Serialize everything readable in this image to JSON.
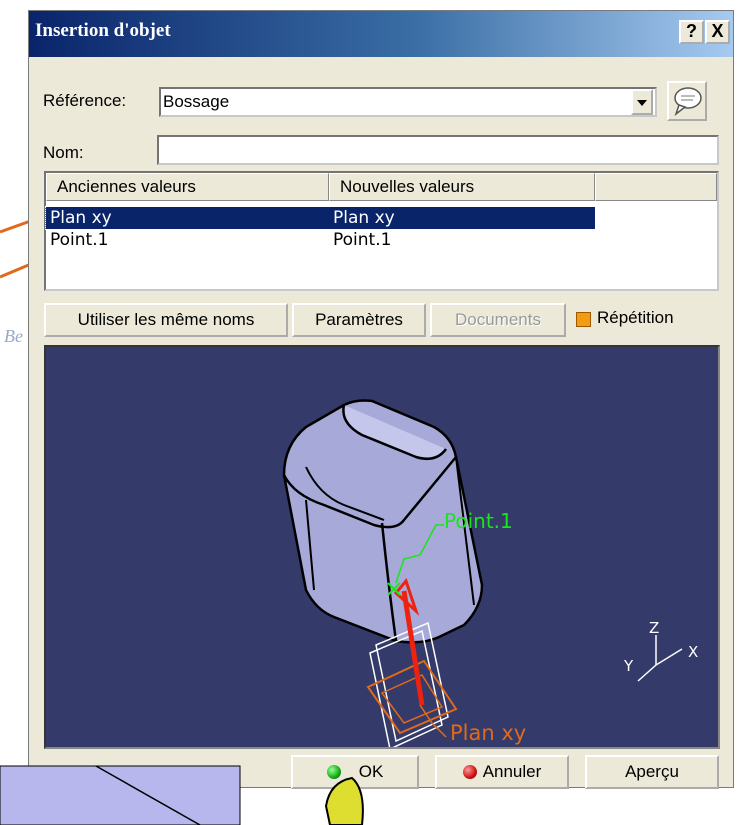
{
  "dialog": {
    "title": "Insertion d'objet",
    "help_button": "?",
    "close_button": "X",
    "reference_label": "Référence:",
    "reference_value": "Bossage",
    "name_label": "Nom:",
    "name_value": "",
    "columns": [
      "Anciennes valeurs",
      "Nouvelles valeurs"
    ],
    "rows": [
      {
        "old": "Plan xy",
        "new": "Plan xy",
        "selected": true
      },
      {
        "old": "Point.1",
        "new": "Point.1",
        "selected": false
      }
    ],
    "buttons": {
      "same_names": "Utiliser les même noms",
      "parameters": "Paramètres",
      "documents": "Documents",
      "repetition": "Répétition"
    },
    "viewer": {
      "point_label": "Point.1",
      "plane_label": "Plan xy",
      "axis_x": "X",
      "axis_y": "Y",
      "axis_z": "Z"
    },
    "footer": {
      "ok": "OK",
      "cancel": "Annuler",
      "preview": "Aperçu"
    }
  },
  "background_text": "Be",
  "colors": {
    "selection": "#0a246a",
    "viewer_bg": "#343a6a",
    "annotation_orange": "#e06a1a",
    "point_green": "#19e619"
  }
}
